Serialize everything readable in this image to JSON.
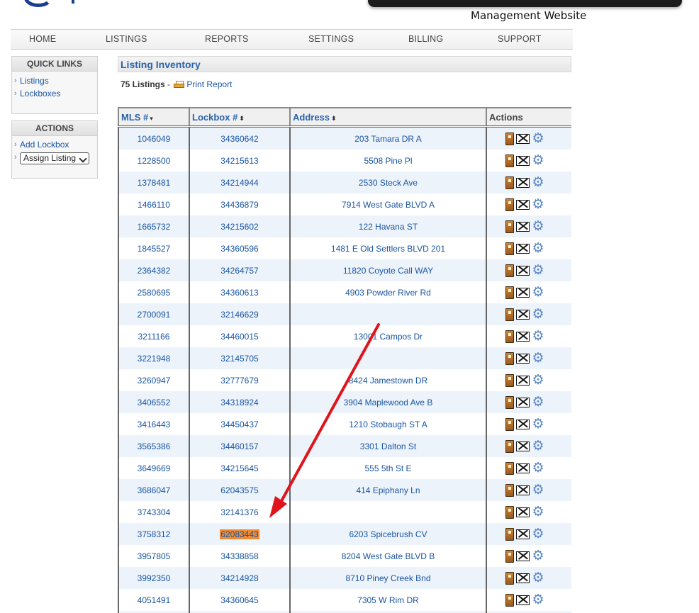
{
  "header": {
    "site_caption": "Management Website"
  },
  "nav": [
    "HOME",
    "LISTINGS",
    "REPORTS",
    "SETTINGS",
    "BILLING",
    "SUPPORT"
  ],
  "quick_links": {
    "title": "QUICK LINKS",
    "items": [
      "Listings",
      "Lockboxes"
    ]
  },
  "actions_box": {
    "title": "ACTIONS",
    "add_lockbox": "Add Lockbox",
    "assign_listing": "Assign Listing"
  },
  "inventory": {
    "title": "Listing Inventory",
    "count": "75 Listings",
    "separator": "-",
    "print_report": "Print Report"
  },
  "table": {
    "headers": {
      "mls": "MLS #",
      "lockbox": "Lockbox #",
      "address": "Address",
      "actions": "Actions"
    },
    "sort_icons": {
      "mls": "▾",
      "lockbox": "⬍",
      "address": "⬍"
    },
    "rows": [
      {
        "mls": "1046049",
        "lockbox": "34360642",
        "address": "203 Tamara DR A"
      },
      {
        "mls": "1228500",
        "lockbox": "34215613",
        "address": "5508 Pine Pl"
      },
      {
        "mls": "1378481",
        "lockbox": "34214944",
        "address": "2530 Steck Ave"
      },
      {
        "mls": "1466110",
        "lockbox": "34436879",
        "address": "7914 West Gate BLVD A"
      },
      {
        "mls": "1665732",
        "lockbox": "34215602",
        "address": "122 Havana ST"
      },
      {
        "mls": "1845527",
        "lockbox": "34360596",
        "address": "1481 E Old Settlers BLVD 201"
      },
      {
        "mls": "2364382",
        "lockbox": "34264757",
        "address": "11820 Coyote Call WAY"
      },
      {
        "mls": "2580695",
        "lockbox": "34360613",
        "address": "4903 Powder River Rd"
      },
      {
        "mls": "2700091",
        "lockbox": "32146629",
        "address": ""
      },
      {
        "mls": "3211166",
        "lockbox": "34460015",
        "address": "13001 Campos Dr"
      },
      {
        "mls": "3221948",
        "lockbox": "32145705",
        "address": ""
      },
      {
        "mls": "3260947",
        "lockbox": "32777679",
        "address": "8424 Jamestown DR"
      },
      {
        "mls": "3406552",
        "lockbox": "34318924",
        "address": "3904 Maplewood Ave B"
      },
      {
        "mls": "3416443",
        "lockbox": "34450437",
        "address": "1210 Stobaugh ST A"
      },
      {
        "mls": "3565386",
        "lockbox": "34460157",
        "address": "3301 Dalton St"
      },
      {
        "mls": "3649669",
        "lockbox": "34215645",
        "address": "555 5th St E"
      },
      {
        "mls": "3686047",
        "lockbox": "62043575",
        "address": "414 Epiphany Ln"
      },
      {
        "mls": "3743304",
        "lockbox": "32141376",
        "address": ""
      },
      {
        "mls": "3758312",
        "lockbox": "62083443",
        "address": "6203 Spicebrush CV",
        "highlight": true
      },
      {
        "mls": "3957805",
        "lockbox": "34338858",
        "address": "8204 West Gate BLVD B"
      },
      {
        "mls": "3992350",
        "lockbox": "34214928",
        "address": "8710 Piney Creek Bnd"
      },
      {
        "mls": "4051491",
        "lockbox": "34360645",
        "address": "7305 W Rim DR"
      },
      {
        "mls": "",
        "lockbox": "",
        "address": ""
      }
    ]
  },
  "colors": {
    "link": "#1a55a3",
    "highlight": "#f08a33",
    "arrow": "#e0141b",
    "row_alt": "#edf3fb"
  },
  "icons": [
    "lockbox-key-icon",
    "mail-icon",
    "gear-icon",
    "printer-icon"
  ]
}
